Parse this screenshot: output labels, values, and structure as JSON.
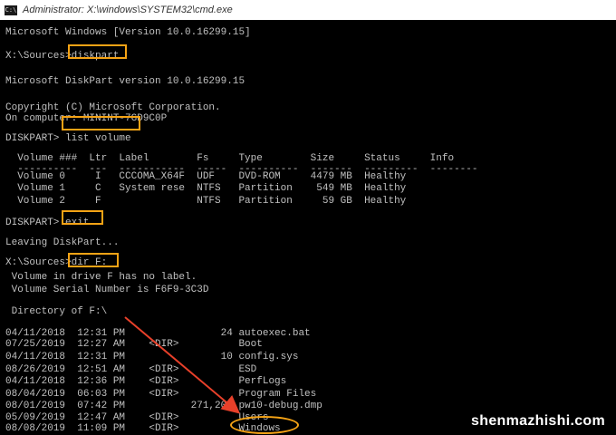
{
  "window": {
    "title": "Administrator: X:\\windows\\SYSTEM32\\cmd.exe",
    "icon": "cmd-icon"
  },
  "console": {
    "lines": [
      "Microsoft Windows [Version 10.0.16299.15]",
      "",
      "X:\\Sources>diskpart",
      "",
      "Microsoft DiskPart version 10.0.16299.15",
      "",
      "Copyright (C) Microsoft Corporation.",
      "On computer: MININT-7GD9C0P",
      "",
      "DISKPART> list volume",
      "",
      "  Volume ###  Ltr  Label        Fs     Type        Size     Status     Info",
      "  ----------  ---  -----------  -----  ----------  -------  ---------  --------",
      "  Volume 0     I   CCCOMA_X64F  UDF    DVD-ROM     4479 MB  Healthy",
      "  Volume 1     C   System rese  NTFS   Partition    549 MB  Healthy",
      "  Volume 2     F                NTFS   Partition     59 GB  Healthy",
      "",
      "DISKPART> exit",
      "",
      "Leaving DiskPart...",
      "",
      "X:\\Sources>dir F:",
      " Volume in drive F has no label.",
      " Volume Serial Number is F6F9-3C3D",
      "",
      " Directory of F:\\",
      "",
      "04/11/2018  12:31 PM                24 autoexec.bat",
      "07/25/2019  12:27 AM    <DIR>          Boot",
      "04/11/2018  12:31 PM                10 config.sys",
      "08/26/2019  12:51 AM    <DIR>          ESD",
      "04/11/2018  12:36 PM    <DIR>          PerfLogs",
      "08/04/2019  06:03 PM    <DIR>          Program Files",
      "08/01/2019  07:42 PM           271,209 pw10-debug.dmp",
      "05/09/2019  12:47 AM    <DIR>          Users",
      "08/08/2019  11:09 PM    <DIR>          Windows"
    ]
  },
  "highlights": {
    "diskpart": "diskpart",
    "list_volume": "list volume",
    "exit": "exit",
    "dir": "dir F:",
    "windows": "Windows"
  },
  "watermark": "shenmazhishi.com",
  "colors": {
    "highlight": "#f5a315",
    "arrow": "#e8402a",
    "console_text": "#c0c0c0",
    "console_bg": "#000000"
  }
}
